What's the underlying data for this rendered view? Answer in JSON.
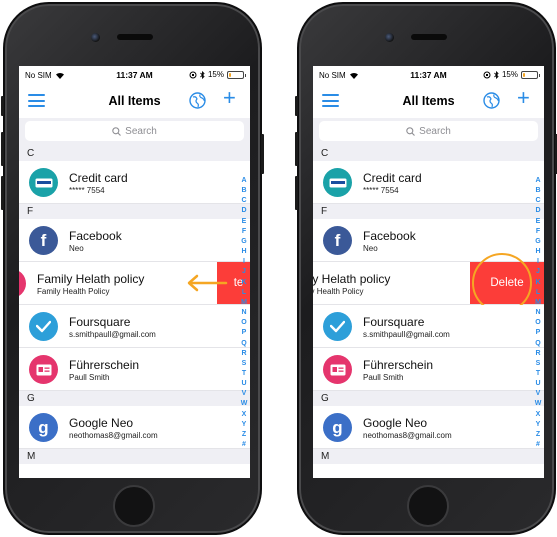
{
  "status_bar": {
    "carrier": "No SIM",
    "time": "11:37 AM",
    "battery": "15%",
    "battery_fraction": 0.15
  },
  "nav": {
    "title": "All Items"
  },
  "search": {
    "placeholder": "Search"
  },
  "sections": [
    {
      "letter": "C",
      "items": [
        {
          "title": "Credit card",
          "subtitle": "***** 7554",
          "icon": "credit-card-icon",
          "color": "#1aa2a8"
        }
      ]
    },
    {
      "letter": "F",
      "items": [
        {
          "title": "Facebook",
          "subtitle": "Neo",
          "icon": "facebook-icon",
          "color": "#3b5998"
        },
        {
          "title": "Family Helath policy",
          "subtitle": "Family Health Policy",
          "icon": "policy-icon",
          "color": "#e5356d"
        },
        {
          "title": "Foursquare",
          "subtitle": "s.smithpaull@gmail.com",
          "icon": "foursquare-icon",
          "color": "#2d9fd9"
        },
        {
          "title": "Führerschein",
          "subtitle": "Paull Smith",
          "icon": "id-card-icon",
          "color": "#e5356d"
        }
      ]
    },
    {
      "letter": "G",
      "items": [
        {
          "title": "Google Neo",
          "subtitle": "neothomas8@gmail.com",
          "icon": "google-icon",
          "color": "#3b6fc7"
        }
      ]
    },
    {
      "letter": "M",
      "items": []
    }
  ],
  "index_letters": [
    "A",
    "B",
    "C",
    "D",
    "E",
    "F",
    "G",
    "H",
    "I",
    "J",
    "K",
    "L",
    "M",
    "N",
    "O",
    "P",
    "Q",
    "R",
    "S",
    "T",
    "U",
    "V",
    "W",
    "X",
    "Y",
    "Z",
    "#"
  ],
  "left_phone": {
    "swiped_title": "Family Helath policy",
    "swiped_subtitle": "Family Health Policy",
    "partial_delete": "te"
  },
  "right_phone": {
    "swiped_title": "ily Helath policy",
    "swiped_subtitle": "ily Health Policy",
    "delete_label": "Delete"
  },
  "colors": {
    "accent": "#2a8ce6",
    "delete": "#fc3d39",
    "annotation": "#f5a623"
  }
}
